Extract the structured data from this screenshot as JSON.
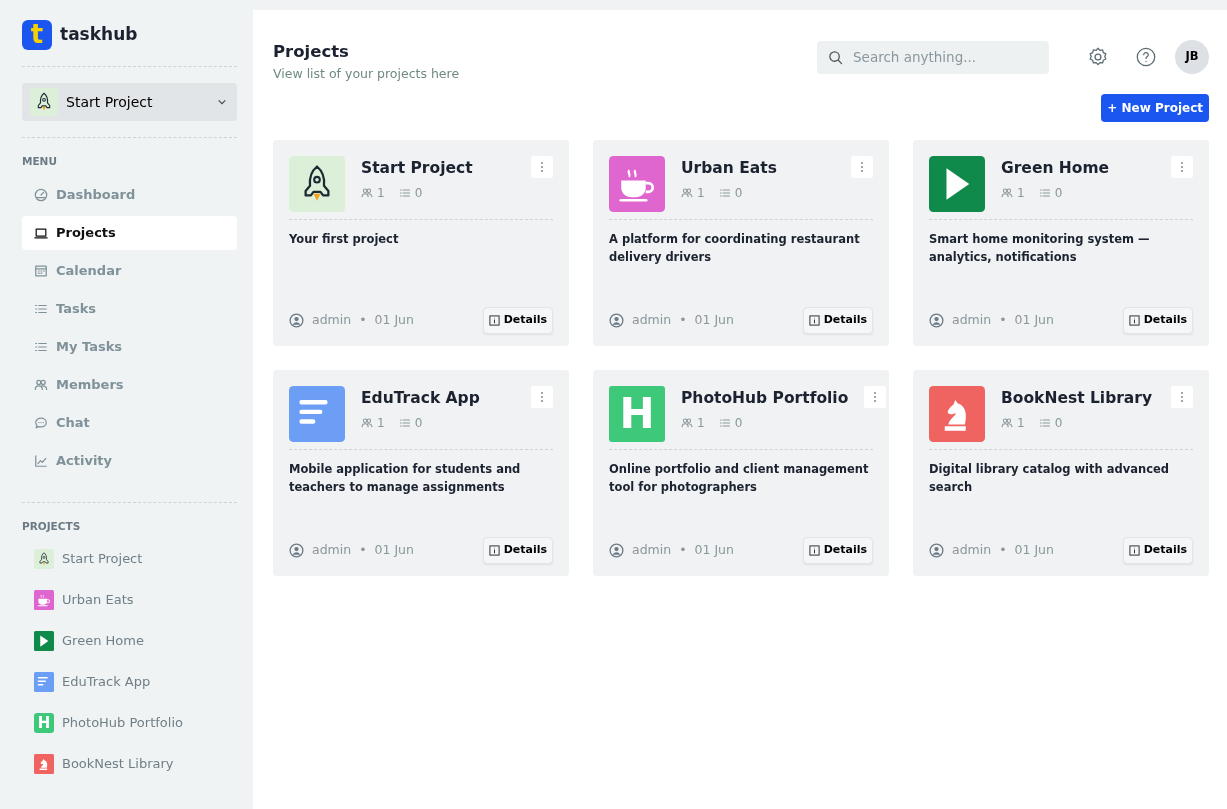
{
  "brand": {
    "logo_glyph": "t",
    "name": "taskhub"
  },
  "project_switcher": {
    "label": "Start Project",
    "kind": "rocket",
    "color": "#dcefd9"
  },
  "menu": {
    "heading": "MENU",
    "items": [
      {
        "label": "Dashboard",
        "kind": "gauge",
        "selected": false
      },
      {
        "label": "Projects",
        "kind": "laptop",
        "selected": true
      },
      {
        "label": "Calendar",
        "kind": "calendar",
        "selected": false
      },
      {
        "label": "Tasks",
        "kind": "list",
        "selected": false
      },
      {
        "label": "My Tasks",
        "kind": "list",
        "selected": false
      },
      {
        "label": "Members",
        "kind": "users",
        "selected": false
      },
      {
        "label": "Chat",
        "kind": "chat",
        "selected": false
      },
      {
        "label": "Activity",
        "kind": "chart",
        "selected": false
      }
    ]
  },
  "projects_nav": {
    "heading": "PROJECTS",
    "items": [
      {
        "label": "Start Project",
        "kind": "rocket",
        "color": "#dcefd9"
      },
      {
        "label": "Urban Eats",
        "kind": "cup",
        "color": "#e066cf"
      },
      {
        "label": "Green Home",
        "kind": "play",
        "color": "#0f8a4a"
      },
      {
        "label": "EduTrack App",
        "kind": "lines",
        "color": "#6d9ef5"
      },
      {
        "label": "PhotoHub Portfolio",
        "kind": "letter",
        "glyph": "H",
        "color": "#3ec97a"
      },
      {
        "label": "BookNest Library",
        "kind": "knight",
        "color": "#ef6461"
      }
    ]
  },
  "header": {
    "title": "Projects",
    "subtitle": "View list of your projects here",
    "search": {
      "placeholder": "Search anything..."
    },
    "avatar": "JB",
    "new_project_button": "+ New Project"
  },
  "cards": [
    {
      "title": "Start Project",
      "kind": "rocket",
      "color": "#dcefd9",
      "members": "1",
      "tasks": "0",
      "description": "Your first project",
      "owner": "admin",
      "bullet": "•",
      "date": "01 Jun",
      "details": "Details"
    },
    {
      "title": "Urban Eats",
      "kind": "cup",
      "color": "#e066cf",
      "members": "1",
      "tasks": "0",
      "description": "A platform for coordinating restaurant delivery drivers",
      "owner": "admin",
      "bullet": "•",
      "date": "01 Jun",
      "details": "Details"
    },
    {
      "title": "Green Home",
      "kind": "play",
      "color": "#0f8a4a",
      "members": "1",
      "tasks": "0",
      "description": "Smart home monitoring system — analytics, notifications",
      "owner": "admin",
      "bullet": "•",
      "date": "01 Jun",
      "details": "Details"
    },
    {
      "title": "EduTrack App",
      "kind": "lines",
      "color": "#6d9ef5",
      "members": "1",
      "tasks": "0",
      "description": "Mobile application for students and teachers to manage assignments",
      "owner": "admin",
      "bullet": "•",
      "date": "01 Jun",
      "details": "Details"
    },
    {
      "title": "PhotoHub Portfolio",
      "kind": "letter",
      "glyph": "H",
      "color": "#3ec97a",
      "members": "1",
      "tasks": "0",
      "description": "Online portfolio and client management tool for photographers",
      "owner": "admin",
      "bullet": "•",
      "date": "01 Jun",
      "details": "Details"
    },
    {
      "title": "BookNest Library",
      "kind": "knight",
      "color": "#ef6461",
      "members": "1",
      "tasks": "0",
      "description": "Digital library catalog with advanced search",
      "owner": "admin",
      "bullet": "•",
      "date": "01 Jun",
      "details": "Details"
    }
  ]
}
